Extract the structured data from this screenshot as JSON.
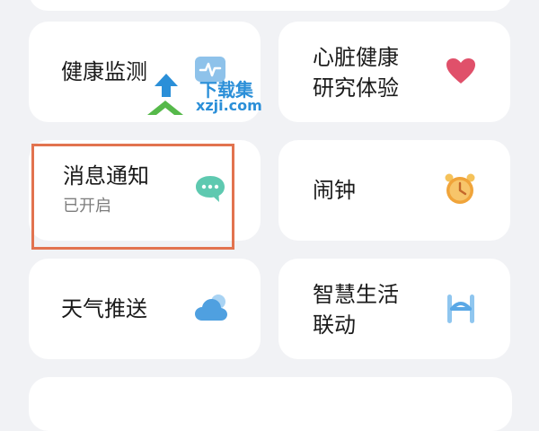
{
  "settings": {
    "items": [
      {
        "label": "健康监测"
      },
      {
        "label_line1": "心脏健康",
        "label_line2": "研究体验"
      },
      {
        "label": "消息通知",
        "status": "已开启"
      },
      {
        "label": "闹钟"
      },
      {
        "label": "天气推送"
      },
      {
        "label_line1": "智慧生活",
        "label_line2": "联动"
      }
    ]
  },
  "watermark": {
    "title": "下载集",
    "domain": "xzji.com"
  },
  "colors": {
    "background": "#f1f2f5",
    "card": "#ffffff",
    "highlight_border": "#e2734f",
    "heart": "#e0506a",
    "message": "#5ec9b0",
    "alarm": "#f0a43a",
    "weather": "#4fa0e0",
    "smart_life": "#5aa8e6"
  },
  "icons": [
    "health-monitor-icon",
    "heart-icon",
    "message-bubble-icon",
    "alarm-clock-icon",
    "weather-cloud-icon",
    "smart-life-icon"
  ]
}
